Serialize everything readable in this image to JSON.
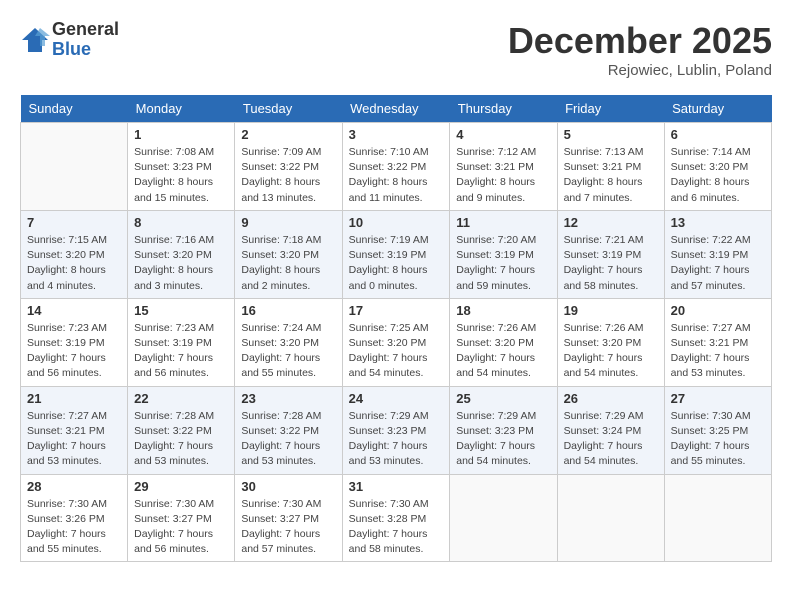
{
  "logo": {
    "general": "General",
    "blue": "Blue"
  },
  "title": "December 2025",
  "location": "Rejowiec, Lublin, Poland",
  "days_of_week": [
    "Sunday",
    "Monday",
    "Tuesday",
    "Wednesday",
    "Thursday",
    "Friday",
    "Saturday"
  ],
  "weeks": [
    [
      {
        "day": "",
        "info": ""
      },
      {
        "day": "1",
        "info": "Sunrise: 7:08 AM\nSunset: 3:23 PM\nDaylight: 8 hours\nand 15 minutes."
      },
      {
        "day": "2",
        "info": "Sunrise: 7:09 AM\nSunset: 3:22 PM\nDaylight: 8 hours\nand 13 minutes."
      },
      {
        "day": "3",
        "info": "Sunrise: 7:10 AM\nSunset: 3:22 PM\nDaylight: 8 hours\nand 11 minutes."
      },
      {
        "day": "4",
        "info": "Sunrise: 7:12 AM\nSunset: 3:21 PM\nDaylight: 8 hours\nand 9 minutes."
      },
      {
        "day": "5",
        "info": "Sunrise: 7:13 AM\nSunset: 3:21 PM\nDaylight: 8 hours\nand 7 minutes."
      },
      {
        "day": "6",
        "info": "Sunrise: 7:14 AM\nSunset: 3:20 PM\nDaylight: 8 hours\nand 6 minutes."
      }
    ],
    [
      {
        "day": "7",
        "info": "Sunrise: 7:15 AM\nSunset: 3:20 PM\nDaylight: 8 hours\nand 4 minutes."
      },
      {
        "day": "8",
        "info": "Sunrise: 7:16 AM\nSunset: 3:20 PM\nDaylight: 8 hours\nand 3 minutes."
      },
      {
        "day": "9",
        "info": "Sunrise: 7:18 AM\nSunset: 3:20 PM\nDaylight: 8 hours\nand 2 minutes."
      },
      {
        "day": "10",
        "info": "Sunrise: 7:19 AM\nSunset: 3:19 PM\nDaylight: 8 hours\nand 0 minutes."
      },
      {
        "day": "11",
        "info": "Sunrise: 7:20 AM\nSunset: 3:19 PM\nDaylight: 7 hours\nand 59 minutes."
      },
      {
        "day": "12",
        "info": "Sunrise: 7:21 AM\nSunset: 3:19 PM\nDaylight: 7 hours\nand 58 minutes."
      },
      {
        "day": "13",
        "info": "Sunrise: 7:22 AM\nSunset: 3:19 PM\nDaylight: 7 hours\nand 57 minutes."
      }
    ],
    [
      {
        "day": "14",
        "info": "Sunrise: 7:23 AM\nSunset: 3:19 PM\nDaylight: 7 hours\nand 56 minutes."
      },
      {
        "day": "15",
        "info": "Sunrise: 7:23 AM\nSunset: 3:19 PM\nDaylight: 7 hours\nand 56 minutes."
      },
      {
        "day": "16",
        "info": "Sunrise: 7:24 AM\nSunset: 3:20 PM\nDaylight: 7 hours\nand 55 minutes."
      },
      {
        "day": "17",
        "info": "Sunrise: 7:25 AM\nSunset: 3:20 PM\nDaylight: 7 hours\nand 54 minutes."
      },
      {
        "day": "18",
        "info": "Sunrise: 7:26 AM\nSunset: 3:20 PM\nDaylight: 7 hours\nand 54 minutes."
      },
      {
        "day": "19",
        "info": "Sunrise: 7:26 AM\nSunset: 3:20 PM\nDaylight: 7 hours\nand 54 minutes."
      },
      {
        "day": "20",
        "info": "Sunrise: 7:27 AM\nSunset: 3:21 PM\nDaylight: 7 hours\nand 53 minutes."
      }
    ],
    [
      {
        "day": "21",
        "info": "Sunrise: 7:27 AM\nSunset: 3:21 PM\nDaylight: 7 hours\nand 53 minutes."
      },
      {
        "day": "22",
        "info": "Sunrise: 7:28 AM\nSunset: 3:22 PM\nDaylight: 7 hours\nand 53 minutes."
      },
      {
        "day": "23",
        "info": "Sunrise: 7:28 AM\nSunset: 3:22 PM\nDaylight: 7 hours\nand 53 minutes."
      },
      {
        "day": "24",
        "info": "Sunrise: 7:29 AM\nSunset: 3:23 PM\nDaylight: 7 hours\nand 53 minutes."
      },
      {
        "day": "25",
        "info": "Sunrise: 7:29 AM\nSunset: 3:23 PM\nDaylight: 7 hours\nand 54 minutes."
      },
      {
        "day": "26",
        "info": "Sunrise: 7:29 AM\nSunset: 3:24 PM\nDaylight: 7 hours\nand 54 minutes."
      },
      {
        "day": "27",
        "info": "Sunrise: 7:30 AM\nSunset: 3:25 PM\nDaylight: 7 hours\nand 55 minutes."
      }
    ],
    [
      {
        "day": "28",
        "info": "Sunrise: 7:30 AM\nSunset: 3:26 PM\nDaylight: 7 hours\nand 55 minutes."
      },
      {
        "day": "29",
        "info": "Sunrise: 7:30 AM\nSunset: 3:27 PM\nDaylight: 7 hours\nand 56 minutes."
      },
      {
        "day": "30",
        "info": "Sunrise: 7:30 AM\nSunset: 3:27 PM\nDaylight: 7 hours\nand 57 minutes."
      },
      {
        "day": "31",
        "info": "Sunrise: 7:30 AM\nSunset: 3:28 PM\nDaylight: 7 hours\nand 58 minutes."
      },
      {
        "day": "",
        "info": ""
      },
      {
        "day": "",
        "info": ""
      },
      {
        "day": "",
        "info": ""
      }
    ]
  ]
}
